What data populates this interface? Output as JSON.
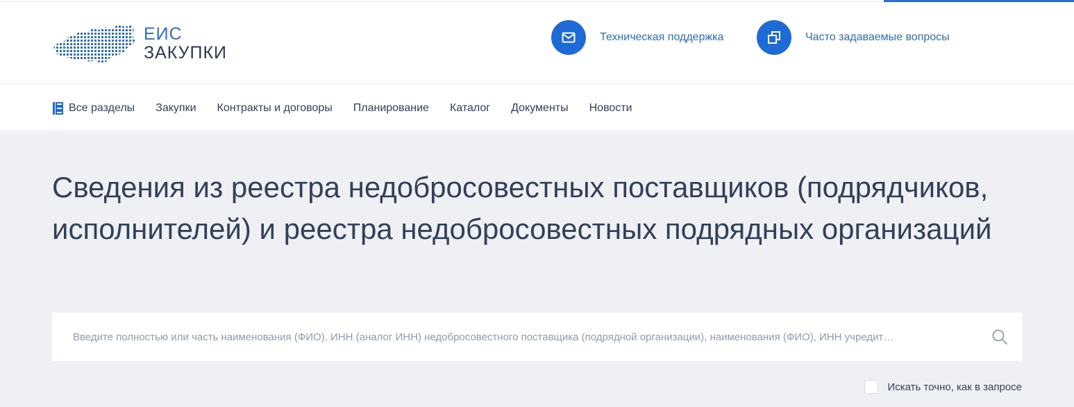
{
  "header": {
    "logo": {
      "line1": "ЕИС",
      "line2": "ЗАКУПКИ"
    },
    "support_label": "Техническая поддержка",
    "faq_label": "Часто задаваемые вопросы"
  },
  "nav": {
    "items": [
      {
        "label": "Все разделы",
        "icon": "sections-grid-icon"
      },
      {
        "label": "Закупки"
      },
      {
        "label": "Контракты и договоры"
      },
      {
        "label": "Планирование"
      },
      {
        "label": "Каталог"
      },
      {
        "label": "Документы"
      },
      {
        "label": "Новости"
      }
    ]
  },
  "main": {
    "title": "Сведения из реестра недобросовестных поставщиков (подрядчиков, исполнителей) и реестра недобросовестных подрядных организаций",
    "search": {
      "placeholder": "Введите полностью или часть наименования (ФИО), ИНН (аналог ИНН) недобросовестного поставщика (подрядной организации), наименования (ФИО), ИНН учредит…",
      "value": ""
    },
    "exact_label": "Искать точно, как в запросе",
    "exact_checked": false
  },
  "colors": {
    "accent": "#1e6bd6",
    "link": "#2a6fc9",
    "text": "#334059",
    "background": "#eef0f3"
  }
}
